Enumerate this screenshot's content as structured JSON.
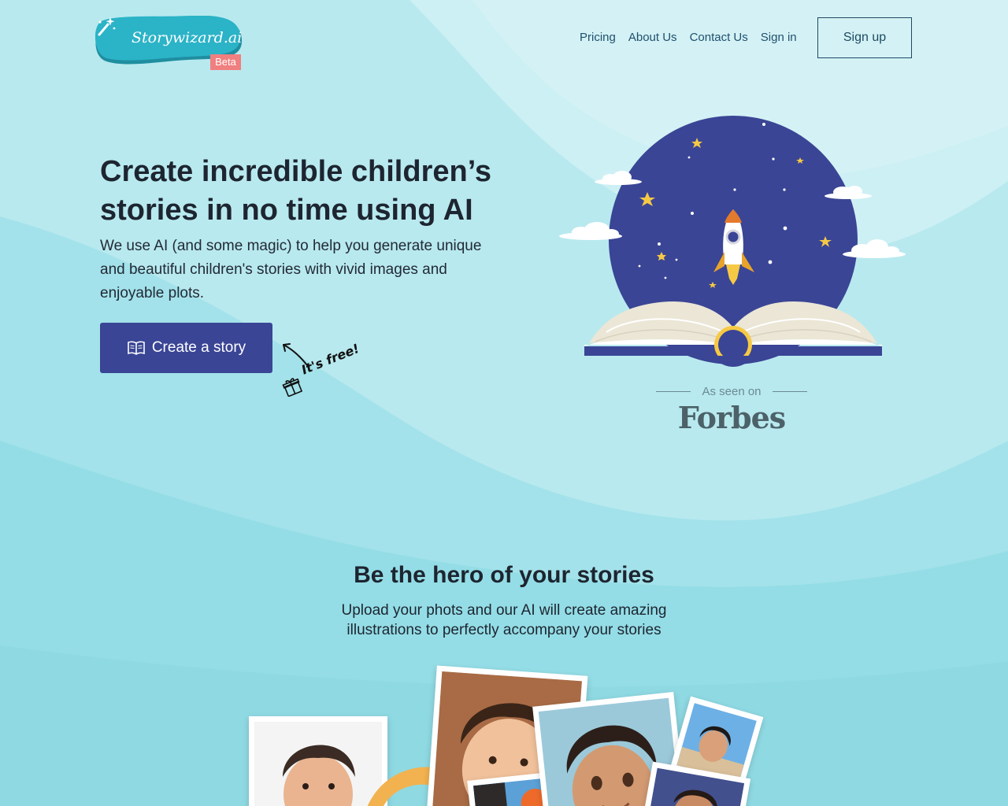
{
  "brand": {
    "name": "Storywizard.ai",
    "badge": "Beta",
    "colors": {
      "accent": "#3a4595",
      "logo_bg": "#2bb3c7",
      "badge": "#f07f7f",
      "background": "#b8e9ef"
    }
  },
  "nav": {
    "links": [
      {
        "label": "Pricing"
      },
      {
        "label": "About Us"
      },
      {
        "label": "Contact Us"
      },
      {
        "label": "Sign in"
      }
    ],
    "signup_label": "Sign up"
  },
  "hero": {
    "title": "Create incredible children’s stories in no time using AI",
    "subtitle": "We use AI (and some magic) to help you generate unique and beautiful children's stories with vivid images and enjoyable plots.",
    "cta_label": "Create a story",
    "cta_icon": "book-icon",
    "free_note": "It's free!",
    "illustration": "rocket-book-illustration"
  },
  "press": {
    "label": "As seen on",
    "outlet": "Forbes"
  },
  "feature": {
    "title": "Be the hero of your stories",
    "subtitle": "Upload your phots and our AI will create amazing illustrations to perfectly accompany your stories",
    "images": [
      "boy-photo",
      "illustrated-boy-portrait",
      "cartoon-boy-portrait",
      "boy-beach-photo"
    ]
  }
}
